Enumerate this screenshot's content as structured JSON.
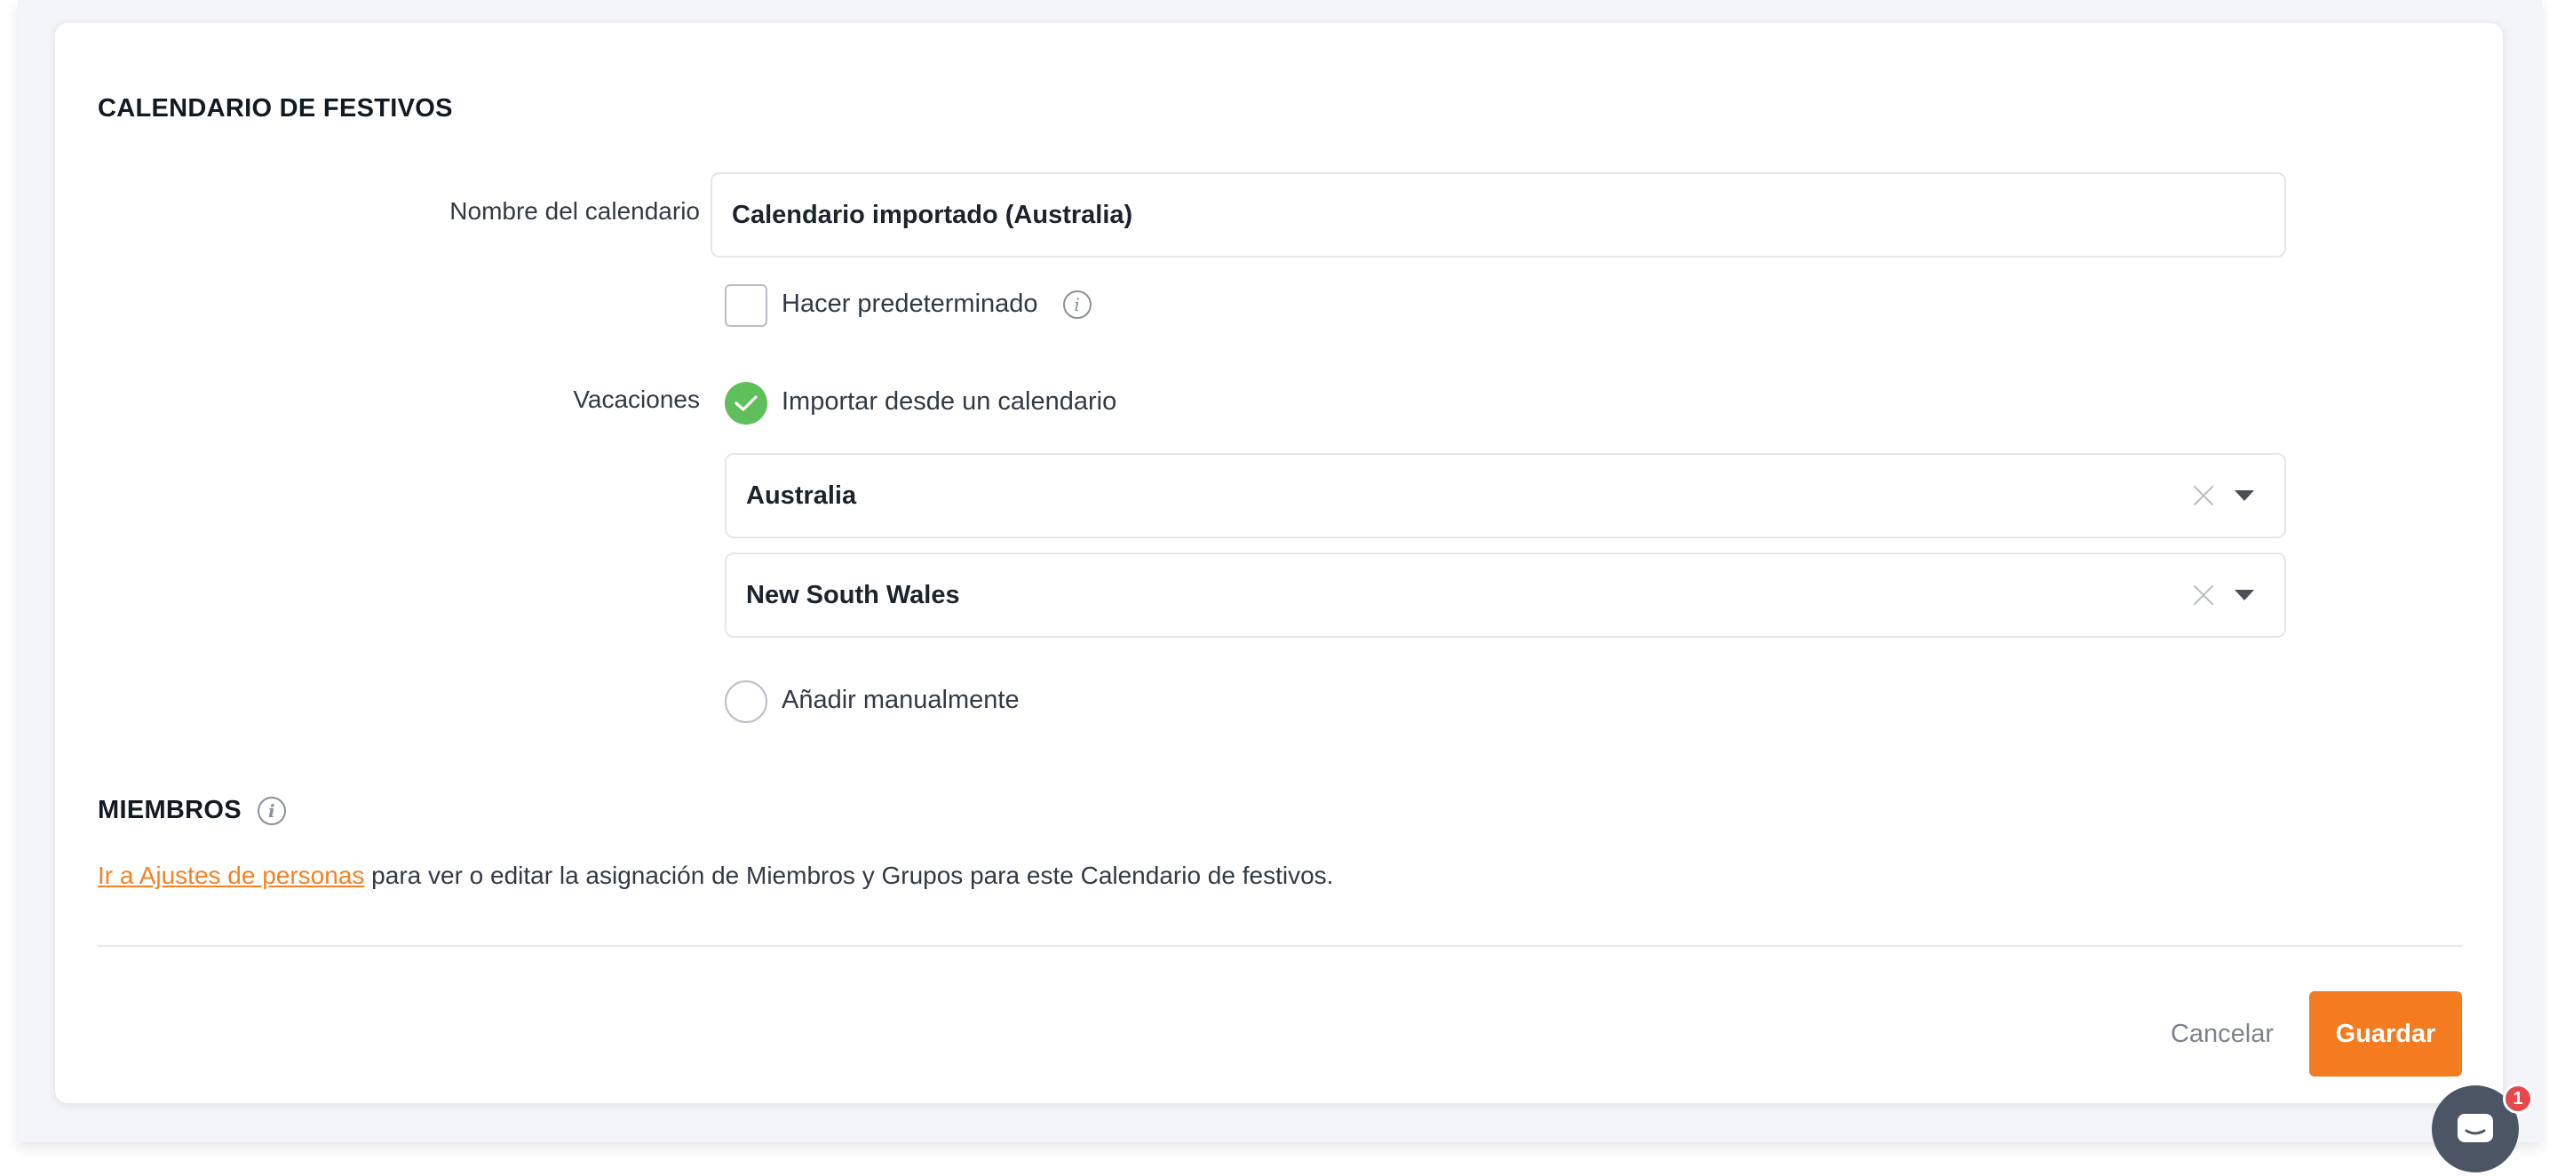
{
  "holiday_calendar": {
    "section_title": "CALENDARIO DE FESTIVOS",
    "name_label": "Nombre del calendario",
    "name_value": "Calendario importado (Australia)",
    "make_default_label": "Hacer predeterminado",
    "make_default_checked": false,
    "holidays_label": "Vacaciones",
    "import_option_label": "Importar desde un calendario",
    "import_option_selected": true,
    "country_select_value": "Australia",
    "region_select_value": "New South Wales",
    "manual_option_label": "Añadir manualmente",
    "manual_option_selected": false
  },
  "members": {
    "section_title": "MIEMBROS",
    "link_text": "Ir a Ajustes de personas",
    "description": " para ver o editar la asignación de Miembros y Grupos para este Calendario de festivos."
  },
  "footer": {
    "cancel_label": "Cancelar",
    "save_label": "Guardar"
  },
  "chat": {
    "badge_count": "1"
  },
  "colors": {
    "accent": "#f47b20",
    "link": "#f58125",
    "success": "#5fbf5a"
  }
}
